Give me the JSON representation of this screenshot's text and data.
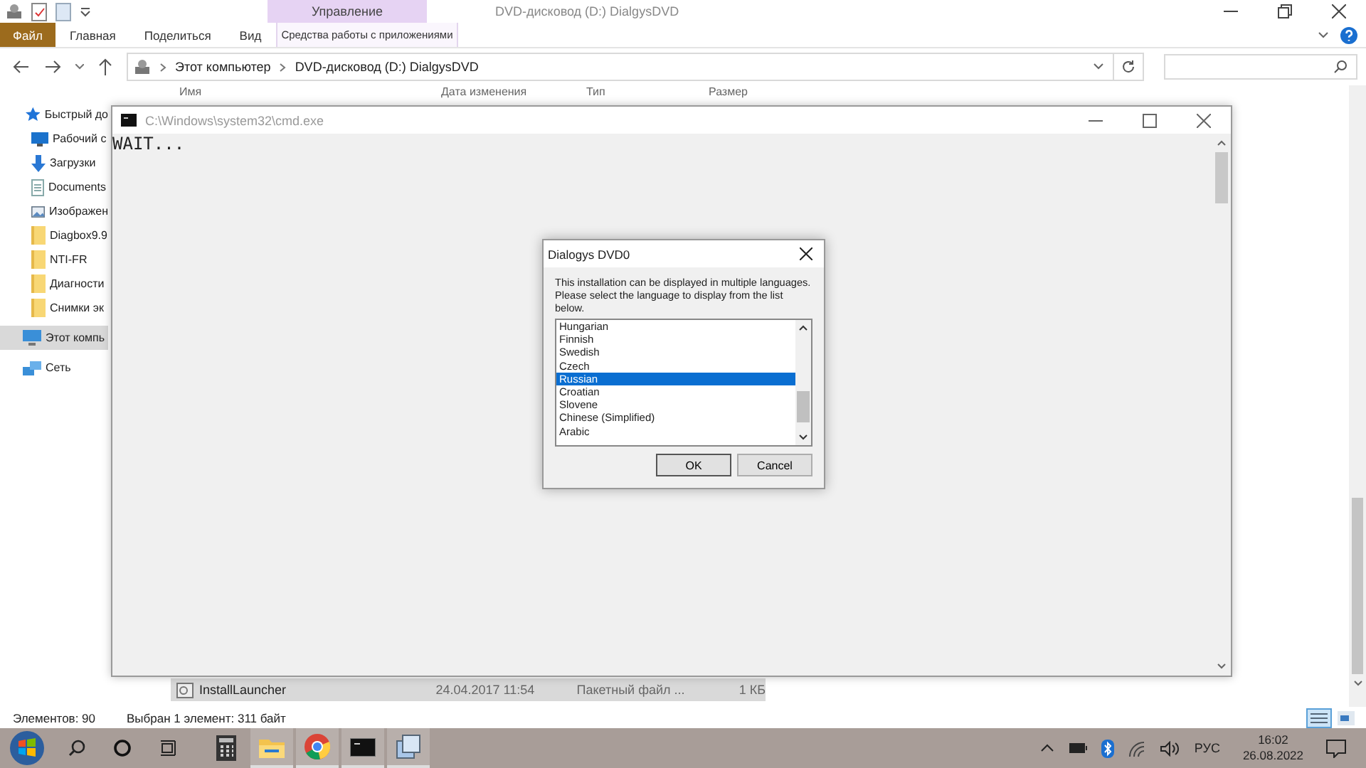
{
  "explorer": {
    "title": "DVD-дисковод (D:) DialgysDVD",
    "context_group": "Управление",
    "ribbon_tabs": [
      {
        "label": "Файл",
        "kind": "file"
      },
      {
        "label": "Главная",
        "kind": "plain"
      },
      {
        "label": "Поделиться",
        "kind": "plain"
      },
      {
        "label": "Вид",
        "kind": "plain"
      },
      {
        "label": "Средства работы с приложениями",
        "kind": "context"
      }
    ],
    "breadcrumbs": [
      "Этот компьютер",
      "DVD-дисковод (D:) DialgysDVD"
    ],
    "sidebar": [
      {
        "label": "Быстрый до",
        "kind": "star",
        "selected": false
      },
      {
        "label": "Рабочий с",
        "kind": "desktop",
        "selected": false
      },
      {
        "label": "Загрузки",
        "kind": "download",
        "selected": false
      },
      {
        "label": "Documents",
        "kind": "document",
        "selected": false
      },
      {
        "label": "Изображен",
        "kind": "pictures",
        "selected": false
      },
      {
        "label": "Diagbox9.9",
        "kind": "folder",
        "selected": false
      },
      {
        "label": "NTI-FR",
        "kind": "folder",
        "selected": false
      },
      {
        "label": "Диагности",
        "kind": "folder",
        "selected": false
      },
      {
        "label": "Снимки эк",
        "kind": "folder",
        "selected": false
      },
      {
        "label": "Этот компь",
        "kind": "pc",
        "selected": true
      },
      {
        "label": "Сеть",
        "kind": "network",
        "selected": false
      }
    ],
    "columns": [
      "Имя",
      "Дата изменения",
      "Тип",
      "Размер"
    ],
    "rows": [
      {
        "cells": [
          "InstallLauncher",
          "24.04.2017 11:54",
          "Пакетный файл ...",
          "1 КБ"
        ],
        "selected": true
      }
    ],
    "status": [
      "Элементов: 90",
      "Выбран 1 элемент: 311 байт"
    ]
  },
  "console": {
    "title": "C:\\Windows\\system32\\cmd.exe",
    "output": "WAIT..."
  },
  "dialog": {
    "title": "Dialogys DVD0",
    "message": "This installation can be displayed in multiple languages. Please select the language to display from the list below.",
    "languages": [
      {
        "name": "Hungarian",
        "selected": false
      },
      {
        "name": "Finnish",
        "selected": false
      },
      {
        "name": "Swedish",
        "selected": false
      },
      {
        "name": "Czech",
        "selected": false
      },
      {
        "name": "Russian",
        "selected": true
      },
      {
        "name": "Croatian",
        "selected": false
      },
      {
        "name": "Slovene",
        "selected": false
      },
      {
        "name": "Chinese (Simplified)",
        "selected": false
      },
      {
        "name": "Arabic",
        "selected": false
      }
    ],
    "buttons": [
      "OK",
      "Cancel"
    ]
  },
  "taskbar": {
    "apps": [
      {
        "kind": "calculator",
        "active": false
      },
      {
        "kind": "explorer",
        "active": true
      },
      {
        "kind": "browser",
        "active": true
      },
      {
        "kind": "console",
        "active": true
      },
      {
        "kind": "installer",
        "active": true
      }
    ],
    "language": "РУС",
    "time": "16:02",
    "date": "26.08.2022"
  }
}
